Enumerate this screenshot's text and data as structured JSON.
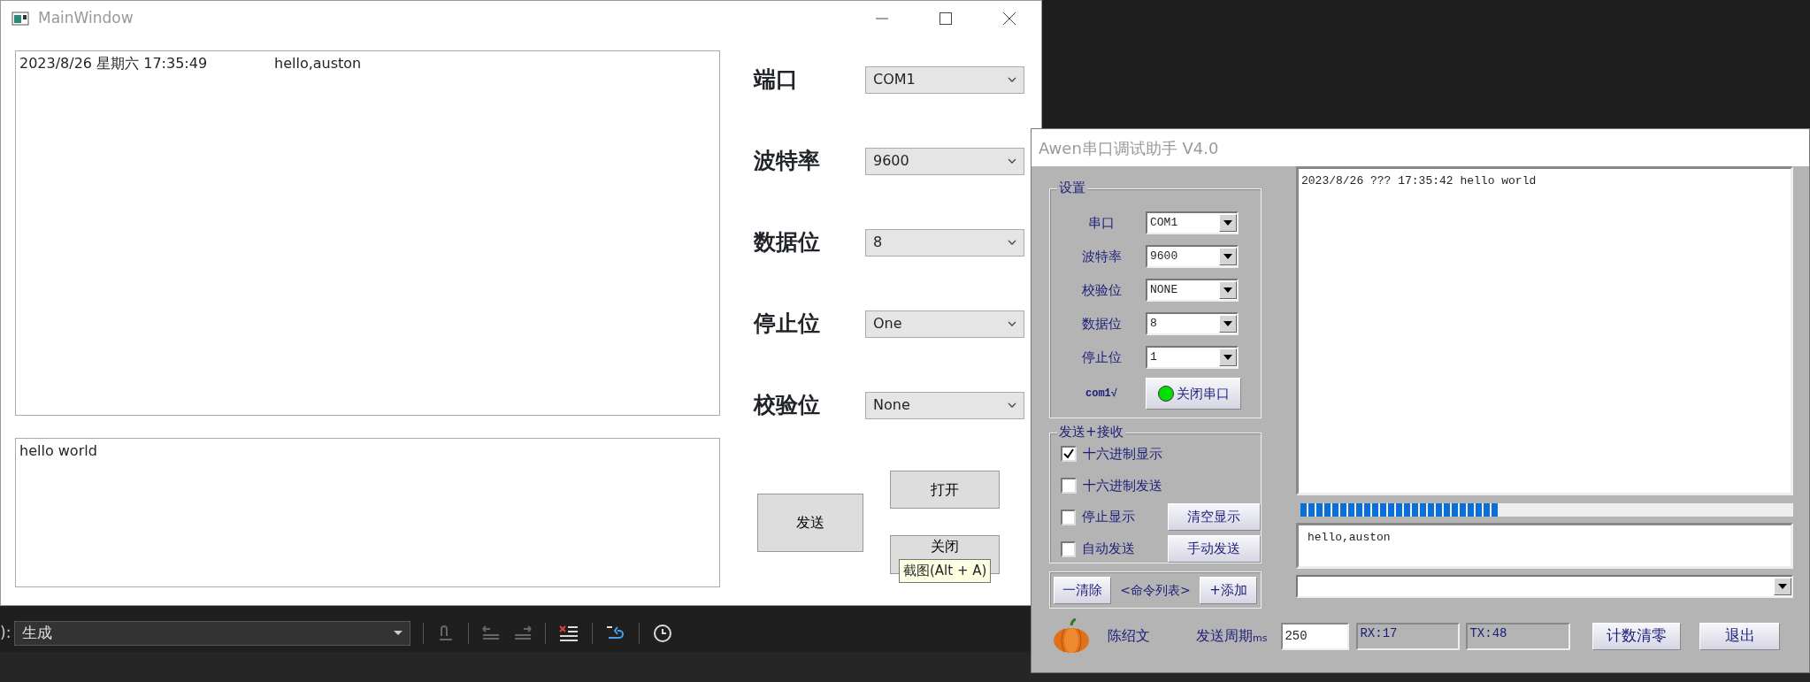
{
  "main_window": {
    "title": "MainWindow",
    "receive_lines": [
      {
        "time": "2023/8/26 星期六 17:35:49",
        "message": "hello,auston"
      }
    ],
    "send_box": {
      "value": "hello world"
    },
    "settings": [
      {
        "label": "端口",
        "value": "COM1"
      },
      {
        "label": "波特率",
        "value": "9600"
      },
      {
        "label": "数据位",
        "value": "8"
      },
      {
        "label": "停止位",
        "value": "One"
      },
      {
        "label": "校验位",
        "value": "None"
      }
    ],
    "send_button": "发送",
    "open_button": "打开",
    "close_button": "关闭",
    "tooltip": "截图(Alt + A)"
  },
  "toolbar": {
    "label": "):",
    "config": "生成"
  },
  "assistant_window": {
    "title": "Awen串口调试助手 V4.0",
    "settings_group": {
      "title": "设置",
      "fields": [
        {
          "label": "串口",
          "value": "COM1"
        },
        {
          "label": "波特率",
          "value": "9600"
        },
        {
          "label": "校验位",
          "value": "NONE"
        },
        {
          "label": "数据位",
          "value": "8"
        },
        {
          "label": "停止位",
          "value": "1"
        }
      ],
      "status": "com1√",
      "port_button": {
        "label": "关闭串口",
        "led_on": true
      }
    },
    "io_group": {
      "title": "发送+接收",
      "options": [
        {
          "label": "十六进制显示",
          "checked": true
        },
        {
          "label": "十六进制发送",
          "checked": false
        },
        {
          "label": "停止显示",
          "checked": false,
          "action": "清空显示"
        },
        {
          "label": "自动发送",
          "checked": false,
          "action": "手动发送"
        }
      ]
    },
    "command_group": {
      "clear_button": "一清除",
      "title": "<命令列表>",
      "add_button": "+添加"
    },
    "receive_text": "2023/8/26 ??? 17:35:42  hello world",
    "progress": {
      "level": 0.4
    },
    "send_text": "hello,auston",
    "author": "陈绍文",
    "period_label": "发送周期",
    "period_unit": "ms",
    "period_value": "250",
    "rx": "RX:17",
    "tx": "TX:48",
    "reset_button": "计数清零",
    "exit_button": "退出"
  }
}
